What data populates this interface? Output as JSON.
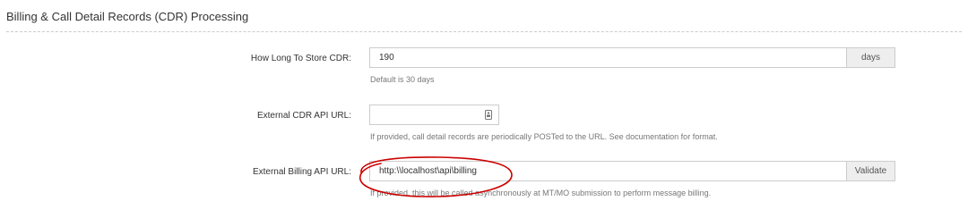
{
  "section": {
    "title": "Billing & Call Detail Records (CDR) Processing"
  },
  "fields": {
    "store_cdr": {
      "label": "How Long To Store CDR:",
      "value": "190",
      "addon": "days",
      "help": "Default is 30 days"
    },
    "external_cdr_api": {
      "label": "External CDR API URL:",
      "value": "",
      "help": "If provided, call detail records are periodically POSTed to the URL. See documentation for format."
    },
    "external_billing_api": {
      "label": "External Billing API URL:",
      "value": "http:\\\\localhost\\api\\billing",
      "addon": "Validate",
      "help": "If provided, this will be called asynchronously at MT/MO submission to perform message billing."
    }
  },
  "annotation": {
    "color": "#cc0000"
  }
}
